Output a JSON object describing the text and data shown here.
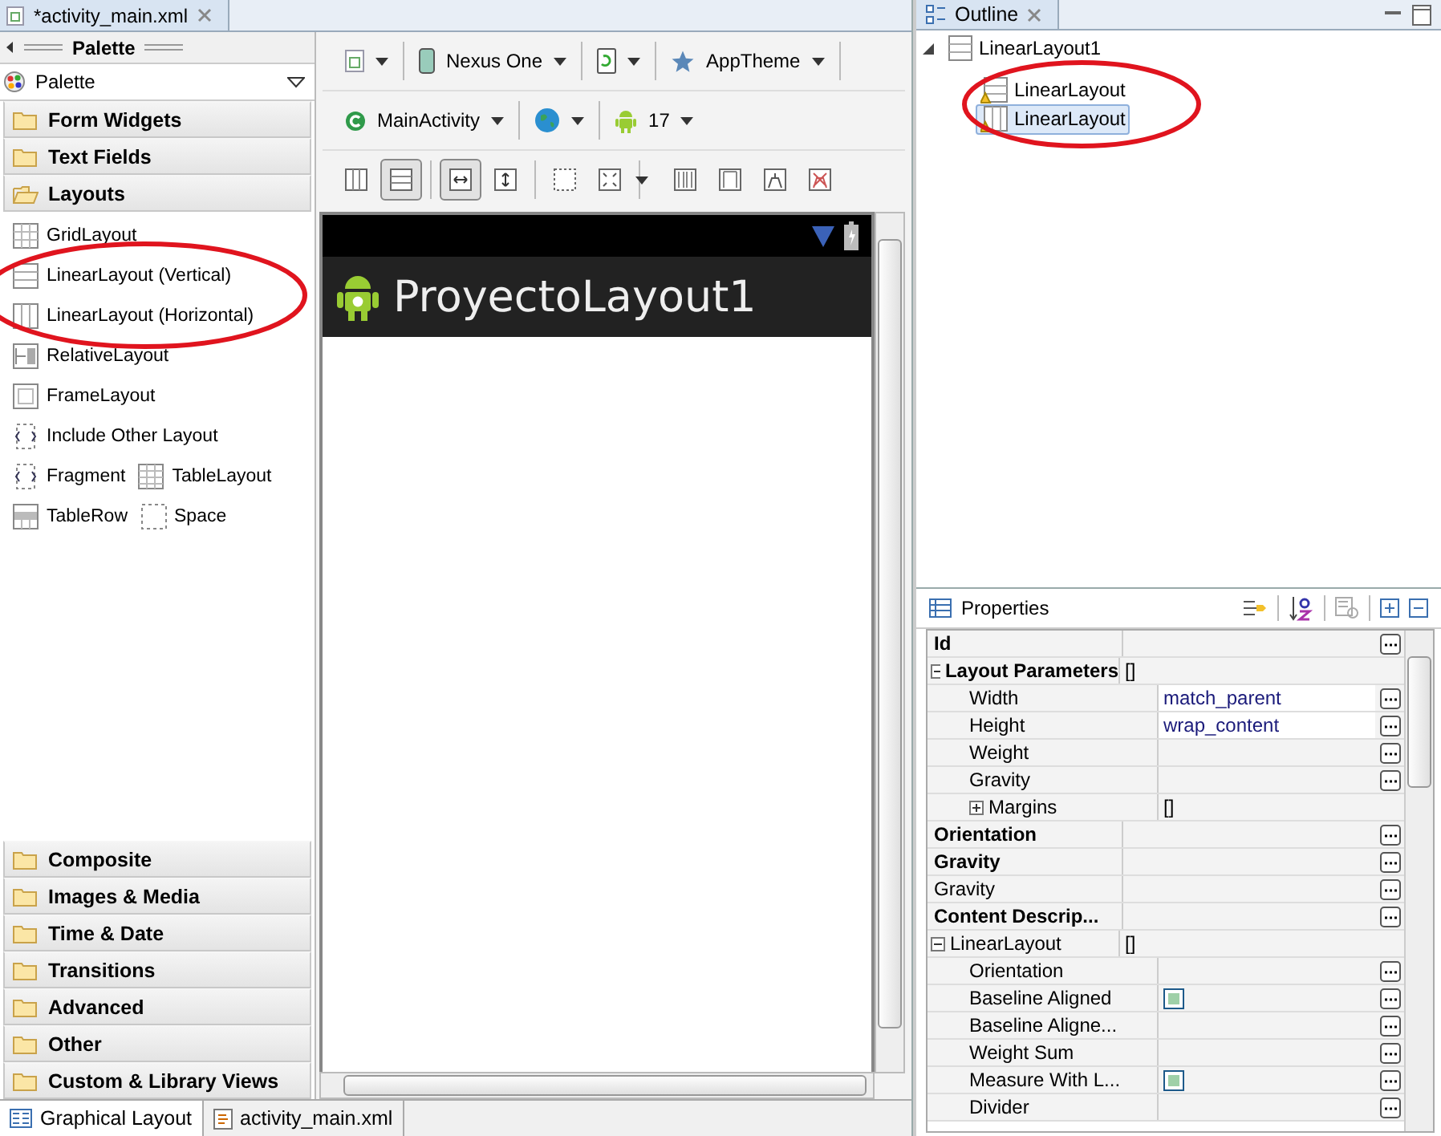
{
  "editor_tab": {
    "title": "*activity_main.xml"
  },
  "palette": {
    "title": "Palette",
    "dropdown": "Palette",
    "categories_top": [
      {
        "label": "Form Widgets",
        "expanded": false
      },
      {
        "label": "Text Fields",
        "expanded": false
      },
      {
        "label": "Layouts",
        "expanded": true
      }
    ],
    "layout_rows": [
      [
        {
          "label": "GridLayout"
        }
      ],
      [
        {
          "label": "LinearLayout (Vertical)"
        }
      ],
      [
        {
          "label": "LinearLayout (Horizontal)"
        }
      ],
      [
        {
          "label": "RelativeLayout"
        }
      ],
      [
        {
          "label": "FrameLayout"
        }
      ],
      [
        {
          "label": "Include Other Layout"
        }
      ],
      [
        {
          "label": "Fragment"
        },
        {
          "label": "TableLayout"
        }
      ],
      [
        {
          "label": "TableRow"
        },
        {
          "label": "Space"
        }
      ]
    ],
    "categories_bottom": [
      {
        "label": "Composite",
        "expanded": false
      },
      {
        "label": "Images & Media",
        "expanded": false
      },
      {
        "label": "Time & Date",
        "expanded": false
      },
      {
        "label": "Transitions",
        "expanded": false
      },
      {
        "label": "Advanced",
        "expanded": false
      },
      {
        "label": "Other",
        "expanded": false
      },
      {
        "label": "Custom & Library Views",
        "expanded": false
      }
    ]
  },
  "toolbar": {
    "row1": [
      {
        "label": "Nexus One"
      },
      {
        "label": "AppTheme"
      }
    ],
    "row2": [
      {
        "label": "MainActivity"
      },
      {
        "label": "17"
      }
    ],
    "toggles": [
      {
        "selected": false
      },
      {
        "selected": true
      },
      {
        "selected": true
      },
      {
        "selected": false
      },
      {
        "selected": false
      },
      {
        "selected": false
      },
      {
        "selected": false
      },
      {
        "selected": false
      },
      {
        "selected": false
      },
      {
        "selected": false
      }
    ]
  },
  "preview": {
    "app_title": "ProyectoLayout1"
  },
  "bottom_tabs": [
    {
      "label": "Graphical Layout",
      "selected": true
    },
    {
      "label": "activity_main.xml",
      "selected": false
    }
  ],
  "outline": {
    "title": "Outline",
    "tree": [
      {
        "label": "LinearLayout1",
        "expanded": true,
        "selected": false,
        "children": [
          {
            "label": "LinearLayout",
            "selected": false
          },
          {
            "label": "LinearLayout",
            "selected": true
          }
        ]
      }
    ]
  },
  "properties": {
    "title": "Properties",
    "rows": [
      {
        "name": "Id",
        "bold": true,
        "editor_button": true
      },
      {
        "name": "Layout Parameters",
        "value": "[]",
        "kind": "group",
        "bold": true,
        "expanded": true,
        "children": [
          {
            "name": "Width",
            "value": "match_parent",
            "bold": false,
            "editor_button": true
          },
          {
            "name": "Height",
            "value": "wrap_content",
            "bold": false,
            "editor_button": true
          },
          {
            "name": "Weight",
            "bold": false,
            "editor_button": true
          },
          {
            "name": "Gravity",
            "bold": false,
            "editor_button": true
          },
          {
            "name": "Margins",
            "value": "[]",
            "kind": "group",
            "bold": false,
            "expanded": false
          }
        ]
      },
      {
        "name": "Orientation",
        "bold": true,
        "editor_button": true
      },
      {
        "name": "Gravity",
        "bold": true,
        "editor_button": true
      },
      {
        "name": "Gravity",
        "bold": false,
        "editor_button": true
      },
      {
        "name": "Content Descrip...",
        "bold": true,
        "editor_button": true
      },
      {
        "name": "LinearLayout",
        "value": "[]",
        "kind": "group",
        "bold": false,
        "expanded": true,
        "children": [
          {
            "name": "Orientation",
            "bold": false,
            "editor_button": true
          },
          {
            "name": "Baseline Aligned",
            "kind": "checkbox",
            "checked": false,
            "bold": false,
            "editor_button": true
          },
          {
            "name": "Baseline Aligne...",
            "bold": false,
            "editor_button": true
          },
          {
            "name": "Weight Sum",
            "bold": false,
            "editor_button": true
          },
          {
            "name": "Measure With L...",
            "kind": "checkbox",
            "checked": false,
            "bold": false,
            "editor_button": true
          },
          {
            "name": "Divider",
            "bold": false,
            "editor_button": true
          }
        ]
      }
    ]
  }
}
